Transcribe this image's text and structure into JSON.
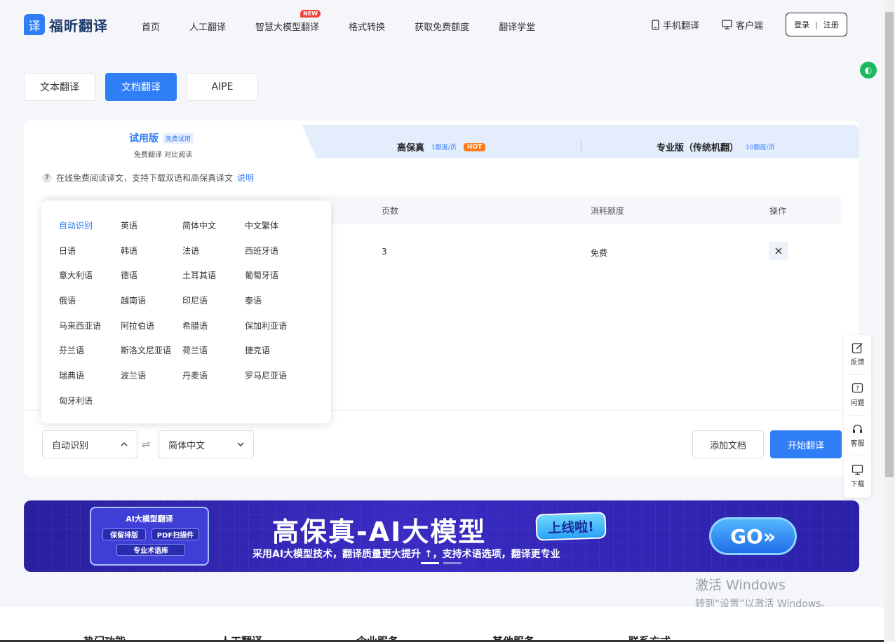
{
  "header": {
    "logo_badge": "译",
    "logo_text": "福昕翻译",
    "nav": [
      "首页",
      "人工翻译",
      "智慧大模型翻译",
      "格式转换",
      "获取免费额度",
      "翻译学堂"
    ],
    "new_badge": "NEW",
    "mobile_label": "手机翻译",
    "client_label": "客户端",
    "login_label": "登录",
    "register_label": "注册"
  },
  "mode_tabs": [
    "文本翻译",
    "文档翻译",
    "AIPE"
  ],
  "versions": {
    "trial_label": "试用版",
    "trial_tag": "免费试用",
    "trial_sub": "免费翻译 对比阅读",
    "hifi_label": "高保真",
    "hifi_tag": "1额度/页",
    "hot_badge": "HOT",
    "pro_label": "专业版（传统机翻）",
    "pro_tag": "10额度/页"
  },
  "hint": {
    "text": "在线免费阅读译文，支持下载双语和高保真译文",
    "link": "说明"
  },
  "table": {
    "headers": {
      "pages": "页数",
      "cost": "消耗额度",
      "action": "操作"
    },
    "row": {
      "pages": "3",
      "cost": "免费"
    }
  },
  "languages": [
    "自动识别",
    "英语",
    "简体中文",
    "中文繁体",
    "日语",
    "韩语",
    "法语",
    "西班牙语",
    "意大利语",
    "德语",
    "土耳其语",
    "葡萄牙语",
    "俄语",
    "越南语",
    "印尼语",
    "泰语",
    "马来西亚语",
    "阿拉伯语",
    "希腊语",
    "保加利亚语",
    "芬兰语",
    "斯洛文尼亚语",
    "荷兰语",
    "捷克语",
    "瑞典语",
    "波兰语",
    "丹麦语",
    "罗马尼亚语",
    "匈牙利语"
  ],
  "source_lang": "自动识别",
  "target_lang": "简体中文",
  "add_doc_label": "添加文档",
  "start_label": "开始翻译",
  "side_bar": [
    "反馈",
    "问题",
    "客服",
    "下载"
  ],
  "banner": {
    "chip_title": "AI大模型翻译",
    "chip_tags": [
      "保留排版",
      "PDF扫描件",
      "专业术语库"
    ],
    "title": "高保真-AI大模型",
    "pill": "上线啦!",
    "subtitle": "采用AI大模型技术，翻译质量更大提升 ↑，支持术语选项，翻译更专业",
    "go": "GO»"
  },
  "watermark": {
    "line1": "激活 Windows",
    "line2": "转到“设置”以激活 Windows。"
  },
  "footer": [
    "热门功能",
    "人工翻译",
    "企业服务",
    "其他服务",
    "联系方式"
  ]
}
